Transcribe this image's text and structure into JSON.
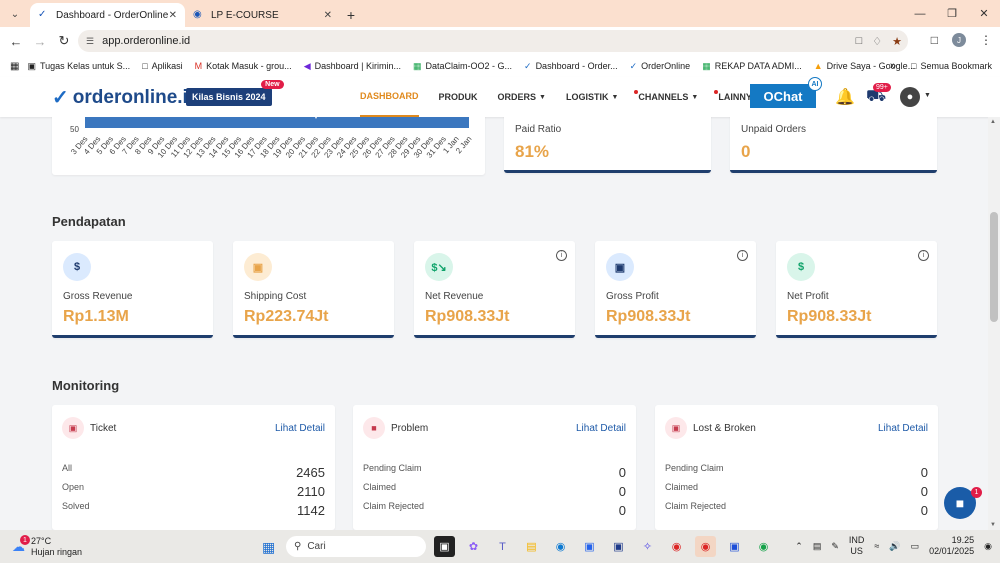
{
  "browser": {
    "tabs": [
      {
        "title": "Dashboard - OrderOnline",
        "active": true
      },
      {
        "title": "LP E-COURSE",
        "active": false
      }
    ],
    "url": "app.orderonline.id",
    "bookmarks": [
      {
        "label": "Tugas Kelas untuk S..."
      },
      {
        "label": "Aplikasi"
      },
      {
        "label": "Kotak Masuk - grou..."
      },
      {
        "label": "Dashboard | Kirimin..."
      },
      {
        "label": "DataClaim-OO2 - G..."
      },
      {
        "label": "Dashboard - Order..."
      },
      {
        "label": "OrderOnline"
      },
      {
        "label": "REKAP DATA ADMI..."
      },
      {
        "label": "Drive Saya - Google..."
      }
    ],
    "all_bookmarks": "Semua Bookmark",
    "profile_initial": "J"
  },
  "header": {
    "logo": "orderonline.id",
    "promo": "Kilas Bisnis 2024",
    "promo_badge": "New",
    "menu": [
      {
        "label": "DASHBOARD"
      },
      {
        "label": "PRODUK"
      },
      {
        "label": "ORDERS"
      },
      {
        "label": "LOGISTIK"
      },
      {
        "label": "CHANNELS"
      },
      {
        "label": "LAINNYA"
      }
    ],
    "ochat": "OChat",
    "ochat_badge": "AI",
    "notif_count": "99+"
  },
  "chart": {
    "y_tick": "50",
    "dates": [
      "3 Des",
      "4 Des",
      "5 Des",
      "6 Des",
      "7 Des",
      "8 Des",
      "9 Des",
      "10 Des",
      "11 Des",
      "12 Des",
      "13 Des",
      "14 Des",
      "15 Des",
      "16 Des",
      "17 Des",
      "18 Des",
      "19 Des",
      "20 Des",
      "21 Des",
      "22 Des",
      "23 Des",
      "24 Des",
      "25 Des",
      "26 Des",
      "27 Des",
      "28 Des",
      "29 Des",
      "30 Des",
      "31 Des",
      "1 Jan",
      "2 Jan"
    ]
  },
  "stats": {
    "paid_ratio": {
      "label": "Paid Ratio",
      "value": "81%"
    },
    "unpaid_orders": {
      "label": "Unpaid Orders",
      "value": "0"
    }
  },
  "pendapatan": {
    "title": "Pendapatan",
    "cards": [
      {
        "label": "Gross Revenue",
        "value": "Rp1.13M"
      },
      {
        "label": "Shipping Cost",
        "value": "Rp223.74Jt"
      },
      {
        "label": "Net Revenue",
        "value": "Rp908.33Jt"
      },
      {
        "label": "Gross Profit",
        "value": "Rp908.33Jt"
      },
      {
        "label": "Net Profit",
        "value": "Rp908.33Jt"
      }
    ]
  },
  "monitoring": {
    "title": "Monitoring",
    "ticket": {
      "title": "Ticket",
      "link": "Lihat Detail",
      "rows": [
        {
          "label": "All",
          "value": "2465"
        },
        {
          "label": "Open",
          "value": "2110"
        },
        {
          "label": "Solved",
          "value": "1142"
        }
      ]
    },
    "problem": {
      "title": "Problem",
      "link": "Lihat Detail",
      "rows": [
        {
          "label": "Pending Claim",
          "value": "0"
        },
        {
          "label": "Claimed",
          "value": "0"
        },
        {
          "label": "Claim Rejected",
          "value": "0"
        }
      ]
    },
    "lost": {
      "title": "Lost & Broken",
      "link": "Lihat Detail",
      "rows": [
        {
          "label": "Pending Claim",
          "value": "0"
        },
        {
          "label": "Claimed",
          "value": "0"
        },
        {
          "label": "Claim Rejected",
          "value": "0"
        }
      ]
    }
  },
  "chat_badge": "1",
  "taskbar": {
    "temp": "27°C",
    "weather": "Hujan ringan",
    "weather_badge": "1",
    "search_placeholder": "Cari",
    "lang_top": "IND",
    "lang_bottom": "US",
    "time": "19.25",
    "date": "02/01/2025"
  },
  "colors": {
    "accent": "#e8a44a",
    "primary": "#1f3e6d",
    "link": "#1e5aa8"
  }
}
